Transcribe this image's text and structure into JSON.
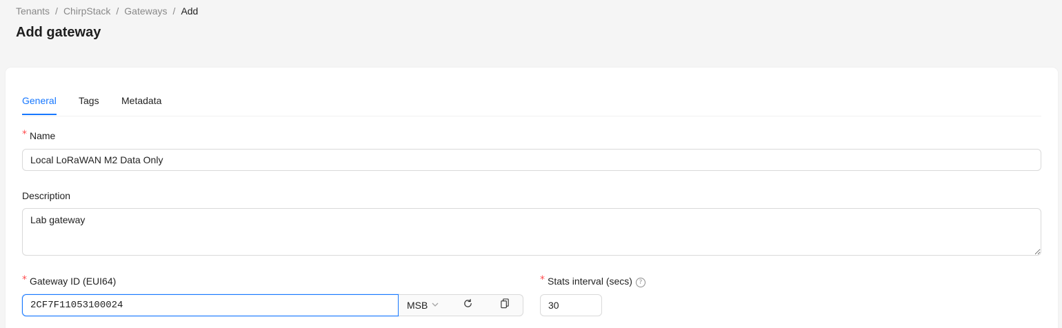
{
  "breadcrumb": {
    "items": [
      "Tenants",
      "ChirpStack",
      "Gateways",
      "Add"
    ],
    "separator": "/"
  },
  "page": {
    "title": "Add gateway"
  },
  "tabs": [
    {
      "label": "General",
      "active": true
    },
    {
      "label": "Tags",
      "active": false
    },
    {
      "label": "Metadata",
      "active": false
    }
  ],
  "form": {
    "required_mark": "*",
    "name": {
      "label": "Name",
      "value": "Local LoRaWAN M2 Data Only"
    },
    "description": {
      "label": "Description",
      "value": "Lab gateway"
    },
    "gateway_id": {
      "label": "Gateway ID (EUI64)",
      "value": "2CF7F11053100024",
      "byte_order": "MSB",
      "refresh_icon": "refresh-icon",
      "copy_icon": "copy-icon"
    },
    "stats_interval": {
      "label": "Stats interval (secs)",
      "value": "30",
      "help_icon": "question-circle-icon"
    }
  },
  "colors": {
    "accent": "#1677ff",
    "required": "#ff4d4f",
    "background": "#f5f5f5"
  }
}
